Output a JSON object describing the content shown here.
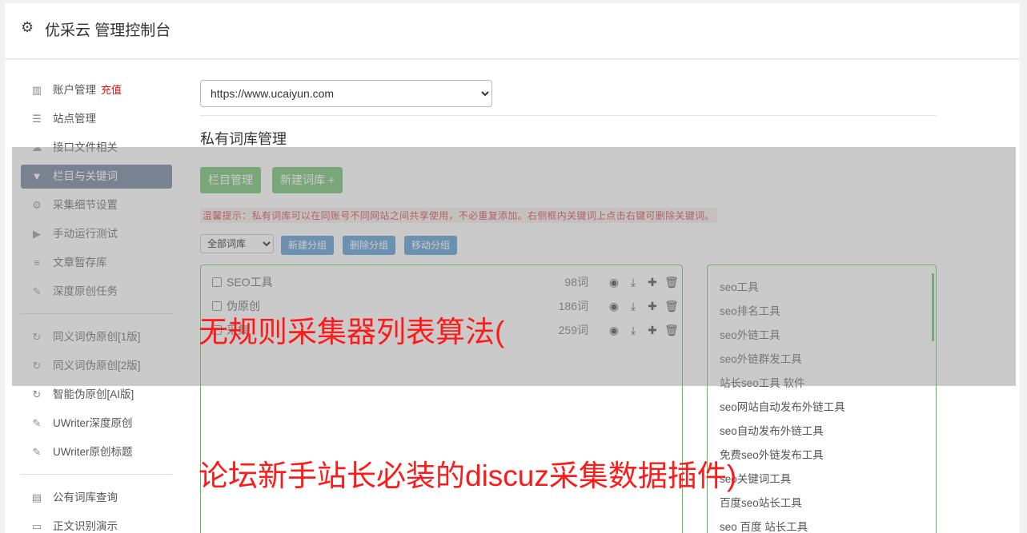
{
  "app": {
    "title": "优采云 管理控制台",
    "icon": "gear-icon"
  },
  "sidebar": {
    "items": [
      {
        "label": "账户管理",
        "badge": "充值",
        "icon": "bar-chart-icon"
      },
      {
        "label": "站点管理",
        "icon": "server-icon"
      },
      {
        "label": "接口文件相关",
        "icon": "cloud-upload-icon"
      },
      {
        "label": "栏目与关键词",
        "icon": "filter-icon",
        "active": true
      },
      {
        "label": "采集细节设置",
        "icon": "cogs-icon"
      },
      {
        "label": "手动运行测试",
        "icon": "play-circle-icon"
      },
      {
        "label": "文章暂存库",
        "icon": "database-icon"
      },
      {
        "label": "深度原创任务",
        "icon": "edit-icon"
      },
      {
        "label": "同义词伪原创[1版]",
        "icon": "refresh-icon"
      },
      {
        "label": "同义词伪原创[2版]",
        "icon": "refresh-icon"
      },
      {
        "label": "智能伪原创[AI版]",
        "icon": "refresh-icon"
      },
      {
        "label": "UWriter深度原创",
        "icon": "edit-icon"
      },
      {
        "label": "UWriter原创标题",
        "icon": "edit-icon"
      },
      {
        "label": "公有词库查询",
        "icon": "book-icon"
      },
      {
        "label": "正文识别演示",
        "icon": "desktop-icon"
      }
    ]
  },
  "main": {
    "site_select": "https://www.ucaiyun.com",
    "section_title": "私有词库管理",
    "buttons": {
      "column_manage": "栏目管理",
      "new_library": "新建词库 +"
    },
    "tip": "温馨提示：私有词库可以在同账号不同网站之间共享使用，不必重复添加。右侧框内关键词上点击右键可删除关键词。",
    "group_select": "全部词库",
    "group_buttons": {
      "new_group": "新建分组",
      "delete_group": "删除分组",
      "move_group": "移动分组"
    },
    "libraries": [
      {
        "name": "SEO工具",
        "count": "98词"
      },
      {
        "name": "伪原创",
        "count": "186词"
      },
      {
        "name": "采集",
        "count": "259词"
      }
    ],
    "keywords": [
      "seo工具",
      "seo排名工具",
      "seo外链工具",
      "seo外链群发工具",
      "站长seo工具 软件",
      "seo网站自动发布外链工具",
      "seo自动发布外链工具",
      "免费seo外链发布工具",
      "seo关键词工具",
      "百度seo站长工具",
      "seo 百度 站长工具"
    ]
  },
  "overlay": {
    "line1": "无规则采集器列表算法(",
    "line2": "论坛新手站长必装的discuz采集数据插件)"
  }
}
